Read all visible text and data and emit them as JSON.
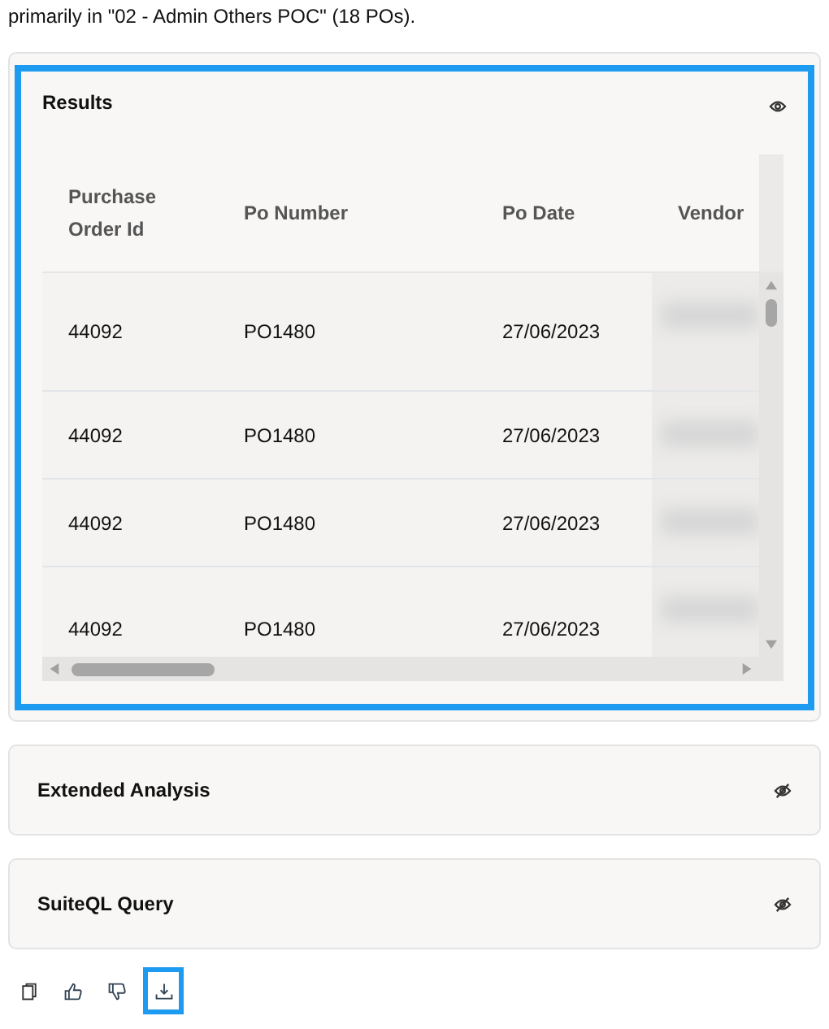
{
  "intro": "primarily in \"02 - Admin Others POC\" (18 POs).",
  "panels": [
    {
      "title": "Results",
      "expanded": true,
      "highlighted": true,
      "table": {
        "columns": [
          "Purchase Order Id",
          "Po Number",
          "Po Date",
          "Vendor"
        ],
        "rows": [
          {
            "cells": [
              "44092",
              "PO1480",
              "27/06/2023"
            ]
          },
          {
            "cells": [
              "44092",
              "PO1480",
              "27/06/2023"
            ]
          },
          {
            "cells": [
              "44092",
              "PO1480",
              "27/06/2023"
            ]
          },
          {
            "cells": [
              "44092",
              "PO1480",
              "27/06/2023"
            ]
          }
        ]
      }
    },
    {
      "title": "Extended Analysis",
      "expanded": false,
      "highlighted": false
    },
    {
      "title": "SuiteQL Query",
      "expanded": false,
      "highlighted": false
    }
  ],
  "actions": [
    {
      "kind": "copy",
      "selected": false
    },
    {
      "kind": "like",
      "selected": false
    },
    {
      "kind": "dislike",
      "selected": false
    },
    {
      "kind": "download",
      "selected": true
    }
  ]
}
